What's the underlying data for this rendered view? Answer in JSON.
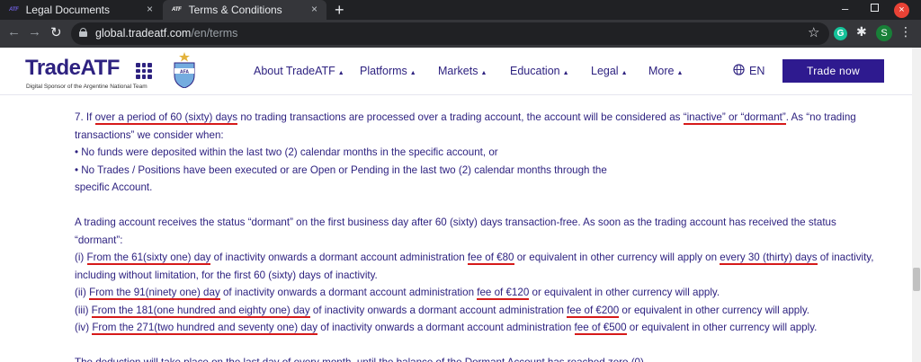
{
  "browser": {
    "tabs": [
      {
        "favicon": "ATF",
        "title": "Legal Documents",
        "close": "×"
      },
      {
        "favicon": "ATF",
        "title": "Terms & Conditions",
        "close": "×"
      }
    ],
    "new_tab": "+",
    "url_domain": "global.tradeatf.com",
    "url_path": "/en/terms",
    "profile_initial": "S",
    "grammarly_initial": "G",
    "icons": [
      "back-icon",
      "forward-icon",
      "reload-icon",
      "lock-icon",
      "star-icon",
      "grammarly-icon",
      "extensions-icon",
      "menu-icon"
    ]
  },
  "site": {
    "logo": "TradeATF",
    "tagline": "Digital Sponsor of the Argentine National Team",
    "brand_color": "#2e2280",
    "nav": [
      {
        "label": "About TradeATF",
        "caret": "▲"
      },
      {
        "label": "Platforms",
        "caret": "▲"
      },
      {
        "label": "Markets",
        "caret": "▲"
      },
      {
        "label": "Education",
        "caret": "▲"
      },
      {
        "label": "Legal",
        "caret": "▲"
      },
      {
        "label": "More",
        "caret": "▲"
      }
    ],
    "lang": "EN",
    "cta": "Trade now"
  },
  "content": {
    "p7": {
      "a": "7. If ",
      "b": "over a period of 60 (sixty) days",
      "c": " no trading transactions are processed over a trading account, the account will be considered as ",
      "d": "“inactive” or “dormant”",
      "e": ". As “no trading",
      "line2": "transactions” we consider when:",
      "bullet1": "• No funds were deposited within the last two (2) calendar months in the specific account, or",
      "bullet2": "• No Trades / Positions have been executed or are Open or Pending in the last two (2) calendar months through the",
      "bullet2b": "specific Account."
    },
    "dormant_intro_1": "A trading account receives the status “dormant” on the first business day after 60 (sixty) days transaction-free. As soon as the trading account has received the status",
    "dormant_intro_2": "“dormant”:",
    "fees": [
      {
        "prefix": "(i) ",
        "period": "From the 61(sixty one) day",
        "mid": " of inactivity onwards a dormant account administration ",
        "fee": "fee of €80",
        "mid2": " or equivalent in other currency will apply on ",
        "freq": "every 30 (thirty) days",
        "tail": " of inactivity,"
      },
      {
        "prefix": "(ii) ",
        "period": "From the 91(ninety one) day",
        "mid": " of inactivity onwards a dormant account administration ",
        "fee": "fee of €120",
        "tail": " or equivalent in other currency will apply."
      },
      {
        "prefix": "(iii) ",
        "period": "From the 181(one hundred and eighty one) day",
        "mid": " of inactivity onwards a dormant account administration ",
        "fee": "fee of €200",
        "tail": " or equivalent in other currency will apply."
      },
      {
        "prefix": "(iv) ",
        "period": "From the 271(two hundred and seventy one) day",
        "mid": " of inactivity onwards a dormant account administration ",
        "fee": "fee of €500",
        "tail": " or equivalent in other currency will apply."
      }
    ],
    "fee1_line2": "including without limitation, for the first 60 (sixty) days of inactivity.",
    "deduction": "The deduction will take place on the last day of every month, until the balance of the Dormant Account has reached zero (0)."
  },
  "colors": {
    "highlight_underline": "#d61a1a",
    "cta_bg": "#2e1a8f",
    "text": "#2e2280"
  }
}
